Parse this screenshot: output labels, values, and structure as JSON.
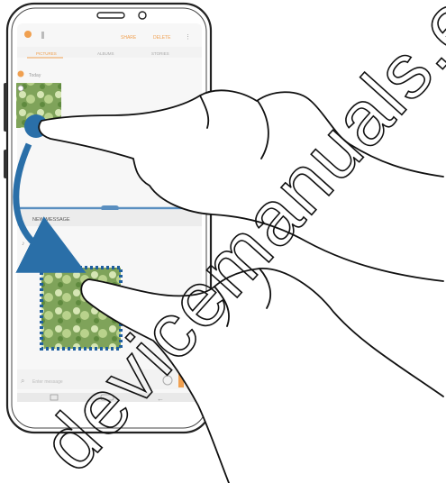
{
  "top_bar": {
    "share_label": "SHARE",
    "delete_label": "DELETE"
  },
  "gallery_tabs": [
    "PICTURES",
    "ALBUMS",
    "STORIES"
  ],
  "gallery": {
    "date_label": "Today"
  },
  "messages": {
    "header_label": "NEW MESSAGE",
    "input_placeholder": "Enter message"
  },
  "watermark": {
    "text": "devicemanuals.eu/"
  },
  "colors": {
    "accent": "#f0a050",
    "arrow": "#2a6fa8",
    "selection_dots": "#1f5f9e",
    "divider": "#5a8fc0",
    "phone_frame": "#222222",
    "screen_bg": "#f7f7f7"
  },
  "icons": {
    "back": "back-arrow-icon",
    "recent": "recent-apps-icon",
    "home": "home-button-icon",
    "emoji": "emoji-icon",
    "attach": "paperclip-icon",
    "more": "more-options-icon",
    "check": "check-icon",
    "drag_arrow": "drag-arrow-icon"
  }
}
